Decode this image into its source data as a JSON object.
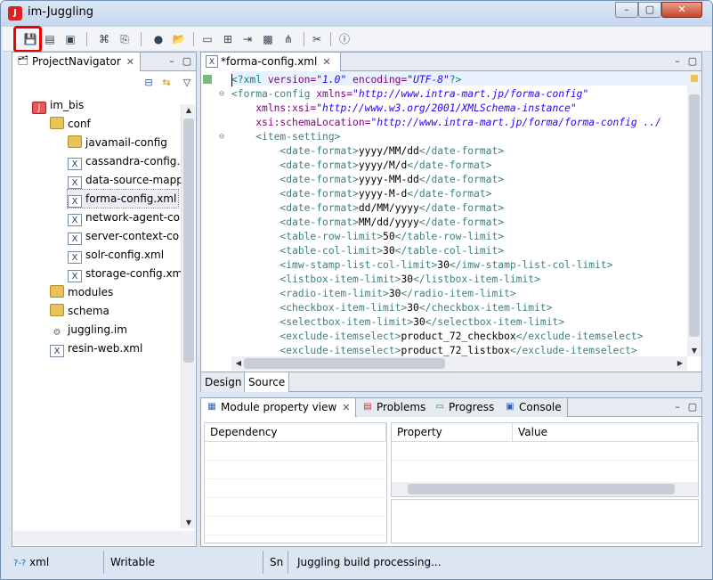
{
  "window": {
    "title": "im-Juggling",
    "close_label": "✕",
    "min_label": "–",
    "max_label": "▢"
  },
  "toolbar": {
    "icons": [
      "save-icon",
      "save-as-icon",
      "save-all-icon",
      "compile-icon",
      "deploy-icon",
      "build-icon",
      "open-folder-icon",
      "monitor-icon",
      "add-server-icon",
      "export-icon",
      "image-icon",
      "hierarchy-icon",
      "tools-icon",
      "info-icon"
    ]
  },
  "navigator": {
    "tab_label": "ProjectNavigator",
    "items": [
      {
        "label": "im_bis",
        "type": "project",
        "indent": 0
      },
      {
        "label": "conf",
        "type": "folder",
        "indent": 1
      },
      {
        "label": "javamail-config",
        "type": "folder",
        "indent": 2
      },
      {
        "label": "cassandra-config.x",
        "type": "xml",
        "indent": 2
      },
      {
        "label": "data-source-mapp",
        "type": "xml",
        "indent": 2
      },
      {
        "label": "forma-config.xml",
        "type": "xml",
        "indent": 2,
        "selected": true
      },
      {
        "label": "network-agent-co",
        "type": "xml",
        "indent": 2
      },
      {
        "label": "server-context-co",
        "type": "xml",
        "indent": 2
      },
      {
        "label": "solr-config.xml",
        "type": "xml",
        "indent": 2
      },
      {
        "label": "storage-config.xm",
        "type": "xml",
        "indent": 2
      },
      {
        "label": "modules",
        "type": "folder",
        "indent": 1
      },
      {
        "label": "schema",
        "type": "folder",
        "indent": 1
      },
      {
        "label": "juggling.im",
        "type": "gear",
        "indent": 1
      },
      {
        "label": "resin-web.xml",
        "type": "xml",
        "indent": 1
      }
    ]
  },
  "editor": {
    "tab_label": "*forma-config.xml",
    "lines": [
      {
        "indent": 0,
        "parts": [
          [
            "pi",
            "<?xml "
          ],
          [
            "attr",
            "version="
          ],
          [
            "str",
            "\"1.0\""
          ],
          [
            "attr",
            " encoding="
          ],
          [
            "str",
            "\"UTF-8\""
          ],
          [
            "pi",
            "?>"
          ]
        ]
      },
      {
        "indent": 0,
        "fold": true,
        "parts": [
          [
            "tag",
            "<forma-config "
          ],
          [
            "attr",
            "xmlns="
          ],
          [
            "str",
            "\"http://www.intra-mart.jp/forma-config\""
          ]
        ]
      },
      {
        "indent": 2,
        "parts": [
          [
            "attr",
            "xmlns:xsi="
          ],
          [
            "str",
            "\"http://www.w3.org/2001/XMLSchema-instance\""
          ]
        ]
      },
      {
        "indent": 2,
        "parts": [
          [
            "attr",
            "xsi:schemaLocation="
          ],
          [
            "str",
            "\"http://www.intra-mart.jp/forma/forma-config ../"
          ]
        ]
      },
      {
        "indent": 2,
        "fold": true,
        "parts": [
          [
            "tag",
            "<item-setting>"
          ]
        ]
      },
      {
        "indent": 4,
        "parts": [
          [
            "tag",
            "<date-format>"
          ],
          [
            "txt",
            "yyyy/MM/dd"
          ],
          [
            "tag",
            "</date-format>"
          ]
        ]
      },
      {
        "indent": 4,
        "parts": [
          [
            "tag",
            "<date-format>"
          ],
          [
            "txt",
            "yyyy/M/d"
          ],
          [
            "tag",
            "</date-format>"
          ]
        ]
      },
      {
        "indent": 4,
        "parts": [
          [
            "tag",
            "<date-format>"
          ],
          [
            "txt",
            "yyyy-MM-dd"
          ],
          [
            "tag",
            "</date-format>"
          ]
        ]
      },
      {
        "indent": 4,
        "parts": [
          [
            "tag",
            "<date-format>"
          ],
          [
            "txt",
            "yyyy-M-d"
          ],
          [
            "tag",
            "</date-format>"
          ]
        ]
      },
      {
        "indent": 4,
        "parts": [
          [
            "tag",
            "<date-format>"
          ],
          [
            "txt",
            "dd/MM/yyyy"
          ],
          [
            "tag",
            "</date-format>"
          ]
        ]
      },
      {
        "indent": 4,
        "parts": [
          [
            "tag",
            "<date-format>"
          ],
          [
            "txt",
            "MM/dd/yyyy"
          ],
          [
            "tag",
            "</date-format>"
          ]
        ]
      },
      {
        "indent": 4,
        "parts": [
          [
            "tag",
            "<table-row-limit>"
          ],
          [
            "txt",
            "50"
          ],
          [
            "tag",
            "</table-row-limit>"
          ]
        ]
      },
      {
        "indent": 4,
        "parts": [
          [
            "tag",
            "<table-col-limit>"
          ],
          [
            "txt",
            "30"
          ],
          [
            "tag",
            "</table-col-limit>"
          ]
        ]
      },
      {
        "indent": 4,
        "parts": [
          [
            "tag",
            "<imw-stamp-list-col-limit>"
          ],
          [
            "txt",
            "30"
          ],
          [
            "tag",
            "</imw-stamp-list-col-limit>"
          ]
        ]
      },
      {
        "indent": 4,
        "parts": [
          [
            "tag",
            "<listbox-item-limit>"
          ],
          [
            "txt",
            "30"
          ],
          [
            "tag",
            "</listbox-item-limit>"
          ]
        ]
      },
      {
        "indent": 4,
        "parts": [
          [
            "tag",
            "<radio-item-limit>"
          ],
          [
            "txt",
            "30"
          ],
          [
            "tag",
            "</radio-item-limit>"
          ]
        ]
      },
      {
        "indent": 4,
        "parts": [
          [
            "tag",
            "<checkbox-item-limit>"
          ],
          [
            "txt",
            "30"
          ],
          [
            "tag",
            "</checkbox-item-limit>"
          ]
        ]
      },
      {
        "indent": 4,
        "parts": [
          [
            "tag",
            "<selectbox-item-limit>"
          ],
          [
            "txt",
            "30"
          ],
          [
            "tag",
            "</selectbox-item-limit>"
          ]
        ]
      },
      {
        "indent": 4,
        "parts": [
          [
            "tag",
            "<exclude-itemselect>"
          ],
          [
            "txt",
            "product_72_checkbox"
          ],
          [
            "tag",
            "</exclude-itemselect>"
          ]
        ]
      },
      {
        "indent": 4,
        "parts": [
          [
            "tag",
            "<exclude-itemselect>"
          ],
          [
            "txt",
            "product_72_listbox"
          ],
          [
            "tag",
            "</exclude-itemselect>"
          ]
        ]
      }
    ],
    "bottom_tabs": [
      "Design",
      "Source"
    ],
    "active_bottom_tab": "Source"
  },
  "bottom_panel": {
    "tabs": [
      {
        "label": "Module property view",
        "icon": "module-icon",
        "active": true
      },
      {
        "label": "Problems",
        "icon": "problems-icon"
      },
      {
        "label": "Progress",
        "icon": "progress-icon"
      },
      {
        "label": "Console",
        "icon": "console-icon"
      }
    ],
    "dependency_header": "Dependency",
    "property_header": "Property",
    "value_header": "Value"
  },
  "status": {
    "type": "xml",
    "mode": "Writable",
    "insert": "Sn",
    "message": "Juggling build processing..."
  }
}
